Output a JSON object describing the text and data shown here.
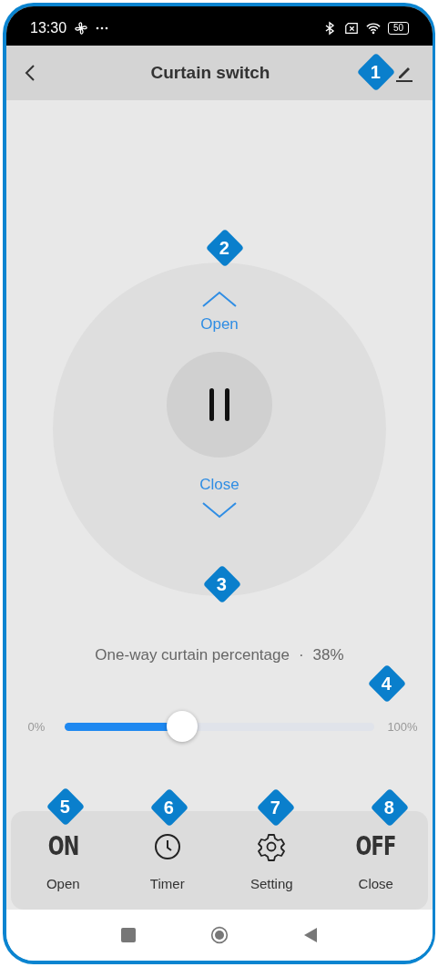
{
  "status_bar": {
    "time": "13:30",
    "battery": "50"
  },
  "header": {
    "title": "Curtain switch"
  },
  "control": {
    "open_label": "Open",
    "close_label": "Close"
  },
  "percentage": {
    "label": "One-way curtain percentage",
    "separator": "·",
    "value": "38%",
    "min": "0%",
    "max": "100%",
    "level": 0.38
  },
  "actions": [
    {
      "kind": "text",
      "glyph": "ON",
      "label": "Open"
    },
    {
      "kind": "clock",
      "label": "Timer"
    },
    {
      "kind": "gear",
      "label": "Setting"
    },
    {
      "kind": "text",
      "glyph": "OFF",
      "label": "Close"
    }
  ],
  "callouts": [
    "1",
    "2",
    "3",
    "4",
    "5",
    "6",
    "7",
    "8"
  ]
}
